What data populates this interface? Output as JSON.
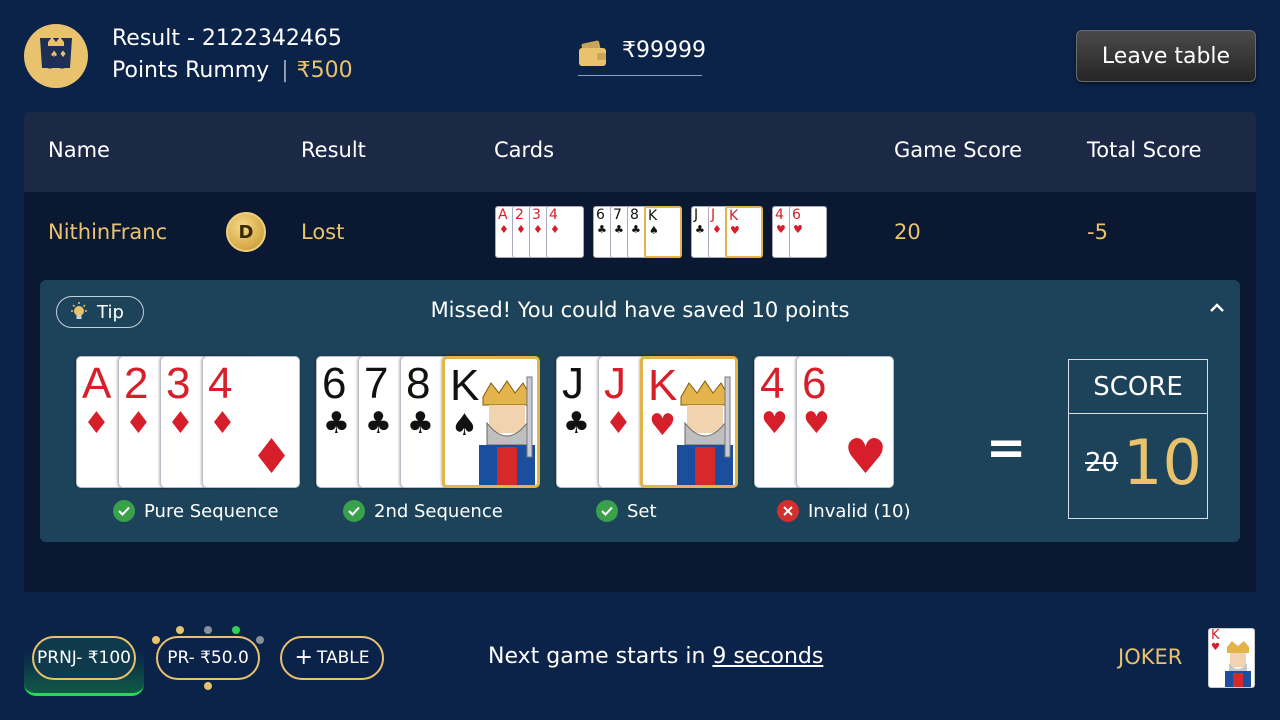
{
  "header": {
    "title": "Result - 2122342465",
    "game_type": "Points Rummy",
    "separator": "|",
    "stake": "₹500",
    "wallet_amount": "₹99999",
    "leave_label": "Leave table"
  },
  "table": {
    "headers": [
      "Name",
      "Result",
      "Cards",
      "Game Score",
      "Total Score"
    ],
    "row": {
      "name": "NithinFranc",
      "dealer_badge": "D",
      "result": "Lost",
      "game_score": "20",
      "total_score": "-5",
      "mini_groups": [
        [
          {
            "rank": "A",
            "suit": "♦"
          },
          {
            "rank": "2",
            "suit": "♦"
          },
          {
            "rank": "3",
            "suit": "♦"
          },
          {
            "rank": "4",
            "suit": "♦"
          }
        ],
        [
          {
            "rank": "6",
            "suit": "♣"
          },
          {
            "rank": "7",
            "suit": "♣"
          },
          {
            "rank": "8",
            "suit": "♣"
          },
          {
            "rank": "K",
            "suit": "♠"
          }
        ],
        [
          {
            "rank": "J",
            "suit": "♣"
          },
          {
            "rank": "J",
            "suit": "♦"
          },
          {
            "rank": "K",
            "suit": "♥"
          }
        ],
        [
          {
            "rank": "4",
            "suit": "♥"
          },
          {
            "rank": "6",
            "suit": "♥"
          }
        ]
      ]
    }
  },
  "tip": {
    "pill_label": "Tip",
    "message": "Missed! You could have saved 10 points",
    "groups": [
      {
        "label": "Pure Sequence",
        "status": "valid",
        "cards": [
          {
            "rank": "A",
            "suit": "♦",
            "color": "red"
          },
          {
            "rank": "2",
            "suit": "♦",
            "color": "red"
          },
          {
            "rank": "3",
            "suit": "♦",
            "color": "red"
          },
          {
            "rank": "4",
            "suit": "♦",
            "color": "red"
          }
        ]
      },
      {
        "label": "2nd Sequence",
        "status": "valid",
        "cards": [
          {
            "rank": "6",
            "suit": "♣",
            "color": "black"
          },
          {
            "rank": "7",
            "suit": "♣",
            "color": "black"
          },
          {
            "rank": "8",
            "suit": "♣",
            "color": "black"
          },
          {
            "rank": "K",
            "suit": "♠",
            "color": "black",
            "joker": true
          }
        ]
      },
      {
        "label": "Set",
        "status": "valid",
        "cards": [
          {
            "rank": "J",
            "suit": "♣",
            "color": "black"
          },
          {
            "rank": "J",
            "suit": "♦",
            "color": "red"
          },
          {
            "rank": "K",
            "suit": "♥",
            "color": "red",
            "joker": true
          }
        ]
      },
      {
        "label": "Invalid (10)",
        "status": "invalid",
        "cards": [
          {
            "rank": "4",
            "suit": "♥",
            "color": "red"
          },
          {
            "rank": "6",
            "suit": "♥",
            "color": "red"
          }
        ]
      }
    ],
    "equals": "=",
    "score_label": "SCORE",
    "old_score": "20",
    "new_score": "10"
  },
  "footer": {
    "tab1": "PRNJ- ₹100",
    "tab2": "PR- ₹50.0",
    "tab3": "TABLE",
    "next_prefix": "Next game starts in",
    "next_seconds": "9 seconds",
    "joker_label": "JOKER",
    "joker_card": {
      "rank": "K",
      "suit": "♥"
    }
  },
  "colors": {
    "background": "#0b2249",
    "gold": "#e9c26e",
    "panel_header": "#1c2946",
    "tip_bg": "#1d435a",
    "valid": "#3aa14b",
    "invalid": "#d42f2f"
  }
}
